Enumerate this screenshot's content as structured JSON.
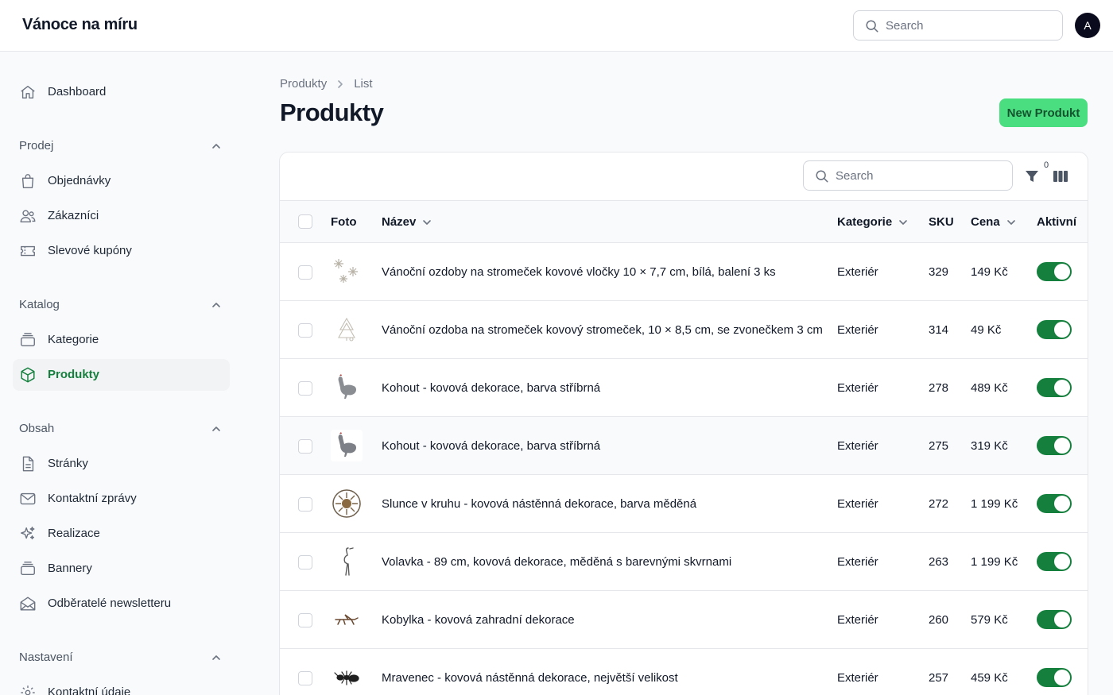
{
  "app": {
    "title": "Vánoce na míru",
    "search_placeholder": "Search",
    "avatar_initial": "A"
  },
  "sidebar": {
    "dashboard": "Dashboard",
    "groups": [
      {
        "label": "Prodej",
        "items": [
          "Objednávky",
          "Zákazníci",
          "Slevové kupóny"
        ]
      },
      {
        "label": "Katalog",
        "items": [
          "Kategorie",
          "Produkty"
        ]
      },
      {
        "label": "Obsah",
        "items": [
          "Stránky",
          "Kontaktní zprávy",
          "Realizace",
          "Bannery",
          "Odběratelé newsletteru"
        ]
      },
      {
        "label": "Nastavení",
        "items": [
          "Kontaktní údaje"
        ]
      }
    ],
    "active_item": "Produkty"
  },
  "breadcrumb": [
    "Produkty",
    "List"
  ],
  "page": {
    "title": "Produkty",
    "new_button": "New Produkt"
  },
  "table": {
    "search_placeholder": "Search",
    "filter_count": "0",
    "columns": [
      "Foto",
      "Název",
      "Kategorie",
      "SKU",
      "Cena",
      "Aktivní"
    ],
    "rows": [
      {
        "thumb": "snowflakes-thumbnail",
        "name": "Vánoční ozdoby na stromeček kovové vločky 10 × 7,7 cm, bílá, balení 3 ks",
        "category": "Exteriér",
        "sku": "329",
        "price": "149 Kč",
        "active": true
      },
      {
        "thumb": "tree-ornament-thumbnail",
        "name": "Vánoční ozdoba na stromeček kovový stromeček, 10 × 8,5 cm, se zvonečkem 3 cm",
        "category": "Exteriér",
        "sku": "314",
        "price": "49 Kč",
        "active": true
      },
      {
        "thumb": "rooster-thumbnail",
        "name": "Kohout - kovová dekorace, barva stříbrná",
        "category": "Exteriér",
        "sku": "278",
        "price": "489 Kč",
        "active": true
      },
      {
        "thumb": "rooster-thumbnail",
        "name": "Kohout - kovová dekorace, barva stříbrná",
        "category": "Exteriér",
        "sku": "275",
        "price": "319 Kč",
        "active": true
      },
      {
        "thumb": "sun-thumbnail",
        "name": "Slunce v kruhu - kovová nástěnná dekorace, barva měděná",
        "category": "Exteriér",
        "sku": "272",
        "price": "1 199 Kč",
        "active": true
      },
      {
        "thumb": "heron-thumbnail",
        "name": "Volavka - 89 cm, kovová dekorace, měděná s barevnými skvrnami",
        "category": "Exteriér",
        "sku": "263",
        "price": "1 199 Kč",
        "active": true
      },
      {
        "thumb": "grasshopper-thumbnail",
        "name": "Kobylka - kovová zahradní dekorace",
        "category": "Exteriér",
        "sku": "260",
        "price": "579 Kč",
        "active": true
      },
      {
        "thumb": "ant-thumbnail",
        "name": "Mravenec - kovová nástěnná dekorace, největší velikost",
        "category": "Exteriér",
        "sku": "257",
        "price": "459 Kč",
        "active": true
      }
    ]
  },
  "colors": {
    "accent": "#15803d",
    "button_bg": "#4ade80",
    "avatar_bg": "#0b0b1e"
  }
}
